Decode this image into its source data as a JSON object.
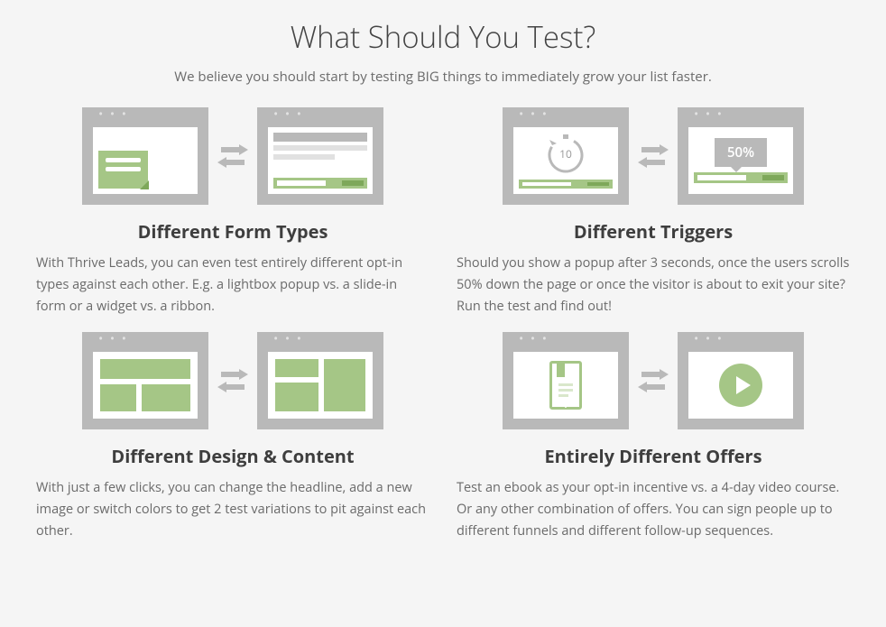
{
  "page": {
    "title": "What Should You Test?",
    "subtitle": "We believe you should start by testing BIG things to immediately grow your list faster."
  },
  "items": [
    {
      "title": "Different Form Types",
      "body": "With Thrive Leads, you can even test entirely different opt-in types against each other. E.g. a lightbox popup vs. a slide-in form or a widget vs. a ribbon."
    },
    {
      "title": "Different Triggers",
      "body": "Should you show a popup after 3 seconds, once the users scrolls 50% down the page or once the visitor is about to exit your site? Run the test and find out!",
      "timer_label": "10",
      "scroll_label": "50%"
    },
    {
      "title": "Different Design & Content",
      "body": "With just a few clicks, you can change the headline, add a new image or switch colors to get 2 test variations to pit against each other."
    },
    {
      "title": "Entirely Different Offers",
      "body": "Test an ebook as your opt-in incentive vs. a 4-day video course. Or any other combination of offers. You can sign people up to different funnels and different follow-up sequences."
    }
  ]
}
